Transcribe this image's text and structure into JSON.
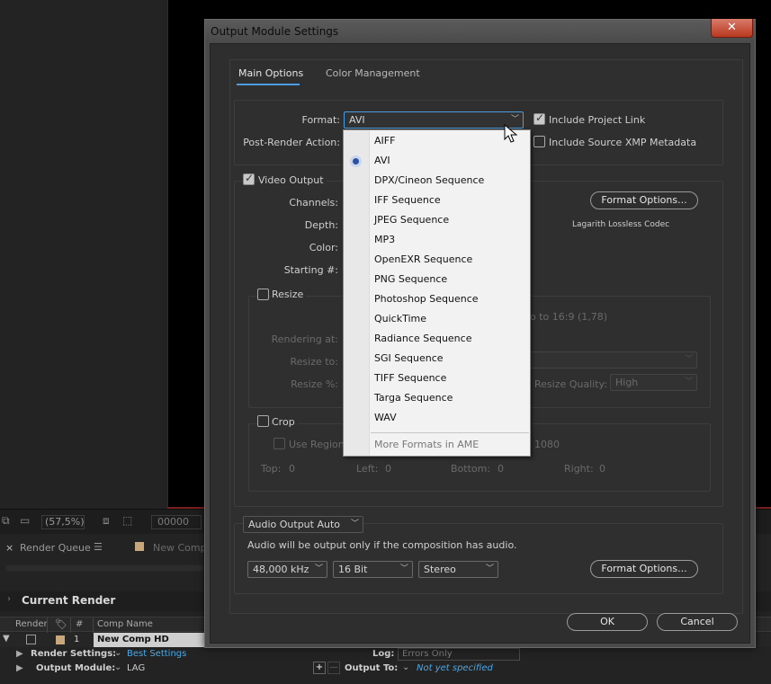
{
  "background": {
    "toolbar": {
      "zoom": "(57,5%)",
      "time": "00000"
    },
    "tabs": {
      "close": "×",
      "render_queue": "Render Queue",
      "menu": "☰",
      "comp": "New Comp"
    },
    "current_render": "Current Render",
    "columns": {
      "render": "Render",
      "number": "#",
      "comp_name": "Comp Name"
    },
    "row": {
      "number": "1",
      "comp_name": "New Comp HD"
    },
    "render_settings": {
      "label": "Render Settings:",
      "value": "Best Settings",
      "log_label": "Log:",
      "log_value": "Errors Only"
    },
    "output_module": {
      "label": "Output Module:",
      "value": "LAG",
      "output_to_label": "Output To:",
      "output_to_value": "Not yet specified",
      "add": "+",
      "remove": "—"
    }
  },
  "dialog": {
    "title": "Output Module Settings",
    "close_glyph": "✕",
    "tabs": [
      {
        "label": "Main Options"
      },
      {
        "label": "Color Management"
      }
    ],
    "format_label": "Format:",
    "format_value": "AVI",
    "post_render_label": "Post-Render Action:",
    "include_project_link": "Include Project Link",
    "include_xmp": "Include Source XMP Metadata",
    "video_output": "Video Output",
    "channels_label": "Channels:",
    "depth_label": "Depth:",
    "color_label": "Color:",
    "starting_label": "Starting #:",
    "format_options": "Format Options...",
    "codec": "Lagarith Lossless Codec",
    "resize": "Resize",
    "aspect_text": "o to 16:9 (1,78)",
    "rendering_at": "Rendering at:",
    "resize_to": "Resize to:",
    "resize_pct": "Resize %:",
    "resize_quality_label": "Resize Quality:",
    "resize_quality_value": "High",
    "crop": "Crop",
    "use_region": "Use Region",
    "crop_size": "1080",
    "top_label": "Top:",
    "top_value": "0",
    "left_label": "Left:",
    "left_value": "0",
    "bottom_label": "Bottom:",
    "bottom_value": "0",
    "right_label": "Right:",
    "right_value": "0",
    "audio_output": "Audio Output Auto",
    "audio_note": "Audio will be output only if the composition has audio.",
    "sample_rate": "48,000 kHz",
    "bit_depth": "16 Bit",
    "channels_audio": "Stereo",
    "audio_format_options": "Format Options...",
    "ok": "OK",
    "cancel": "Cancel",
    "format_list": [
      "AIFF",
      "AVI",
      "DPX/Cineon Sequence",
      "IFF Sequence",
      "JPEG Sequence",
      "MP3",
      "OpenEXR Sequence",
      "PNG Sequence",
      "Photoshop Sequence",
      "QuickTime",
      "Radiance Sequence",
      "SGI Sequence",
      "TIFF Sequence",
      "Targa Sequence",
      "WAV"
    ],
    "format_more": "More Formats in AME"
  },
  "colors": {
    "accent": "#4a9de0",
    "close": "#c8442a",
    "link": "#4aa8e6"
  }
}
